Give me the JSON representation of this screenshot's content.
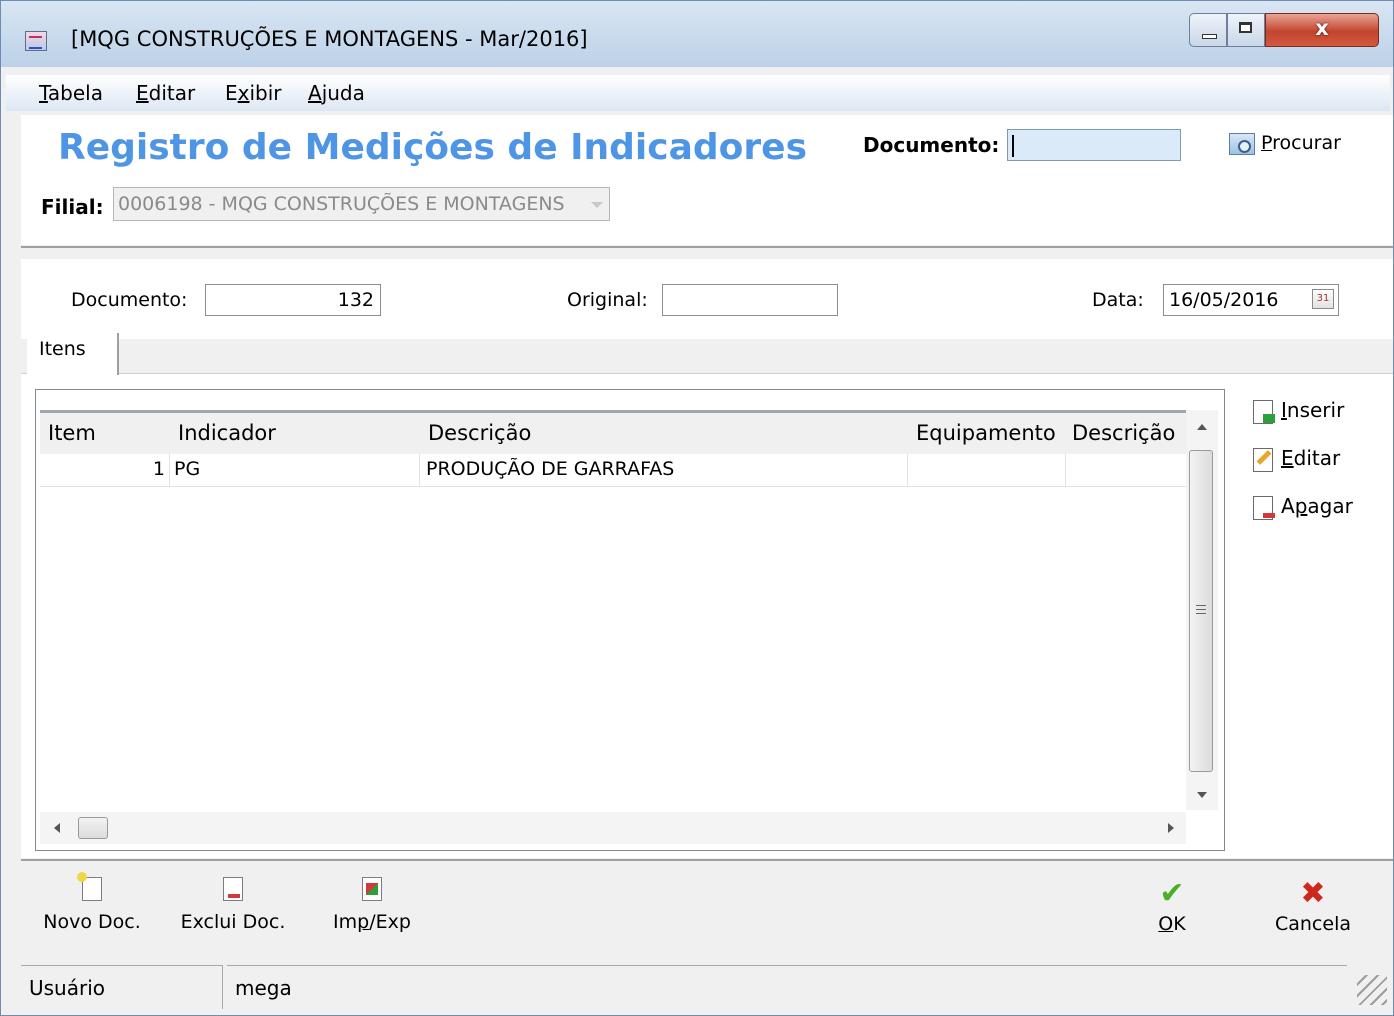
{
  "window": {
    "title": "[MQG CONSTRUÇÕES E MONTAGENS - Mar/2016]",
    "close_glyph": "x"
  },
  "menu": [
    {
      "pre": "",
      "mn": "T",
      "post": "abela"
    },
    {
      "pre": "",
      "mn": "E",
      "post": "ditar"
    },
    {
      "pre": "E",
      "mn": "x",
      "post": "ibir"
    },
    {
      "pre": "",
      "mn": "A",
      "post": "juda"
    }
  ],
  "header": {
    "title": "Registro de Medições de Indicadores",
    "documento_label": "Documento:",
    "documento_value": "",
    "procurar": {
      "mn": "P",
      "post": "rocurar"
    },
    "filial_label": "Filial:",
    "filial_value": "0006198 - MQG CONSTRUÇÕES E MONTAGENS"
  },
  "form": {
    "documento_label": "Documento:",
    "documento_value": "132",
    "original_label": "Original:",
    "original_value": "",
    "data_label": "Data:",
    "data_value": "16/05/2016"
  },
  "tabs": [
    {
      "label": "Itens"
    }
  ],
  "grid": {
    "columns": [
      "Item",
      "Indicador",
      "Descrição",
      "Equipamento",
      "Descrição"
    ],
    "rows": [
      {
        "item": "1",
        "indicador": "PG",
        "descricao": "PRODUÇÃO DE GARRAFAS",
        "equipamento": "",
        "descricao2": ""
      }
    ]
  },
  "side_actions": {
    "inserir": {
      "mn": "I",
      "post": "nserir"
    },
    "editar": {
      "mn": "E",
      "post": "ditar"
    },
    "apagar": {
      "pre": "A",
      "mn": "p",
      "post": "agar"
    }
  },
  "toolbar": {
    "novo": "Novo Doc.",
    "exclui": "Exclui Doc.",
    "impexp": {
      "pre": "Im",
      "mn": "p",
      "post": "/Exp"
    },
    "ok": {
      "mn": "O",
      "post": "K"
    },
    "cancela": "Cancela"
  },
  "status": {
    "label": "Usuário",
    "value": "mega"
  },
  "colors": {
    "title_blue": "#4f95e6",
    "field_blue": "#dbeaf9",
    "ok_green": "#4caf2c",
    "cancel_red": "#d0271d"
  }
}
